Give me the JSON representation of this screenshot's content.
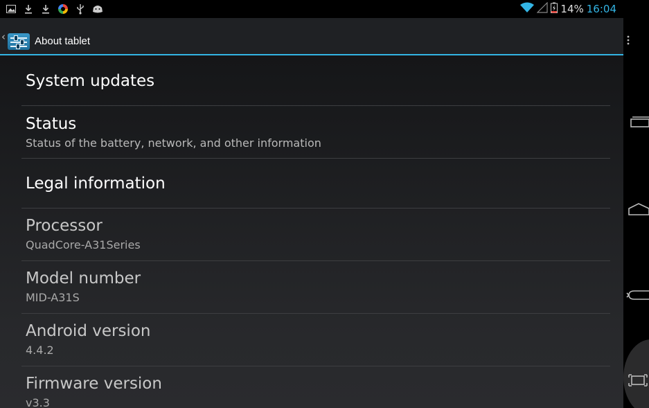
{
  "status_bar": {
    "notification_icons": [
      "gallery-icon",
      "download-icon",
      "download-icon",
      "sync-icon",
      "usb-icon",
      "android-debug-icon"
    ],
    "battery_percent": "14%",
    "time": "16:04",
    "wifi": "connected",
    "signal": "no-signal"
  },
  "action_bar": {
    "title": "About tablet",
    "overflow_icon": "overflow-menu-icon",
    "accent": "#33b5e5"
  },
  "settings": [
    {
      "title": "System updates",
      "summary": ""
    },
    {
      "title": "Status",
      "summary": "Status of the battery, network, and other information"
    },
    {
      "title": "Legal information",
      "summary": ""
    },
    {
      "title": "Processor",
      "summary": "QuadCore-A31Series"
    },
    {
      "title": "Model number",
      "summary": "MID-A31S"
    },
    {
      "title": "Android version",
      "summary": "4.4.2"
    },
    {
      "title": "Firmware version",
      "summary": "v3.3"
    }
  ],
  "nav_bar": {
    "buttons": [
      "recent-apps-icon",
      "home-icon",
      "back-icon",
      "screenshot-icon"
    ]
  }
}
